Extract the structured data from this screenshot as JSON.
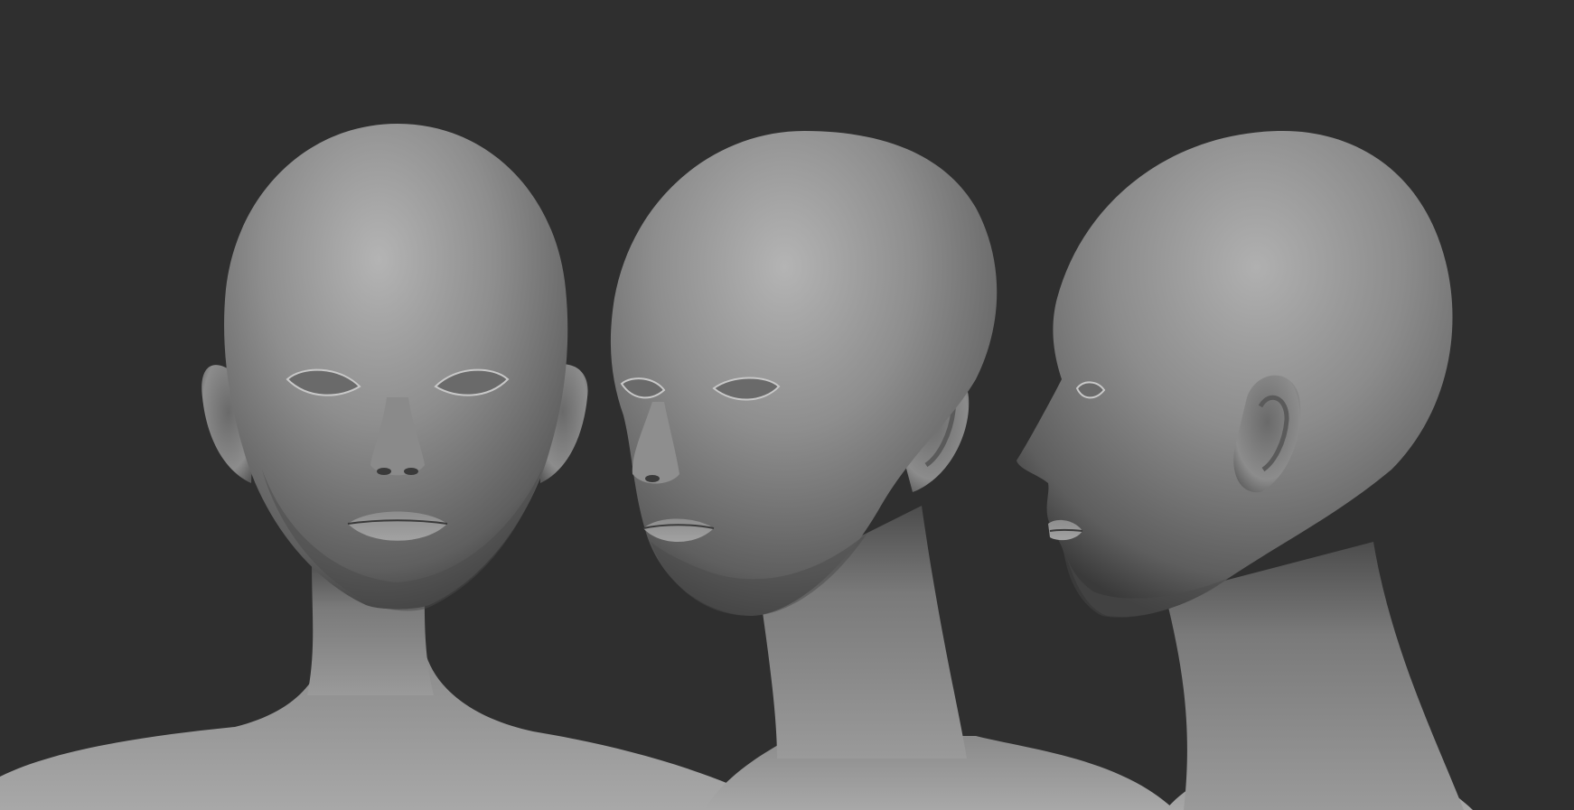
{
  "scene": {
    "background_color": "#2f2f2f",
    "clay_color": "#8c8c8c",
    "views": [
      {
        "view": "front"
      },
      {
        "view": "three-quarter"
      },
      {
        "view": "profile"
      }
    ]
  }
}
